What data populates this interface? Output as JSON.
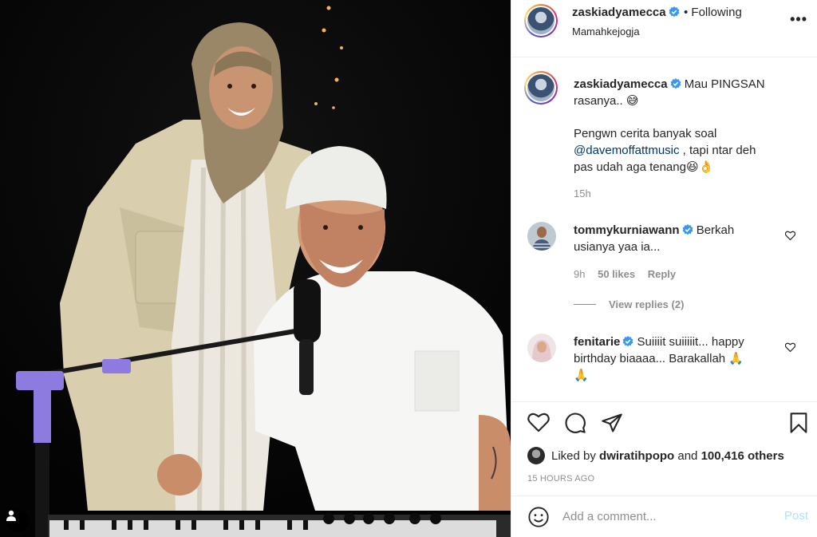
{
  "post": {
    "username": "zaskiadyamecca",
    "follow_status": "• Following",
    "location": "Mamahkejogja",
    "caption_line1": "Mau PINGSAN",
    "caption_line2": "rasanya..",
    "caption_emoji1": "😅",
    "caption_p2_line1": "Pengwn cerita banyak soal",
    "caption_mention": "@davemoffattmusic",
    "caption_p2_line2b": " , tapi ntar deh",
    "caption_p2_line3": "pas udah aga tenang😆👌",
    "caption_time": "15h"
  },
  "comments": [
    {
      "username": "tommykurniawann",
      "text_line1": "Berkah",
      "text_line2": "usianya yaa ia...",
      "time": "9h",
      "likes": "50 likes",
      "reply": "Reply",
      "view_replies": "View replies (2)"
    },
    {
      "username": "fenitarie",
      "text_line1": "Suiiiit suiiiiit... happy",
      "text_line2": "birthday biaaaa... Barakallah 🙏",
      "text_line3": "🙏"
    }
  ],
  "actions": {
    "liked_prefix": "Liked by ",
    "liked_user": "dwiratihpopo",
    "liked_and": " and ",
    "liked_count": "100,416 others",
    "timestamp": "15 HOURS AGO"
  },
  "add_comment": {
    "placeholder": "Add a comment...",
    "post_label": "Post"
  },
  "colors": {
    "verified": "#3897f0",
    "link": "#00376b",
    "post_disabled": "#b2dffc"
  }
}
